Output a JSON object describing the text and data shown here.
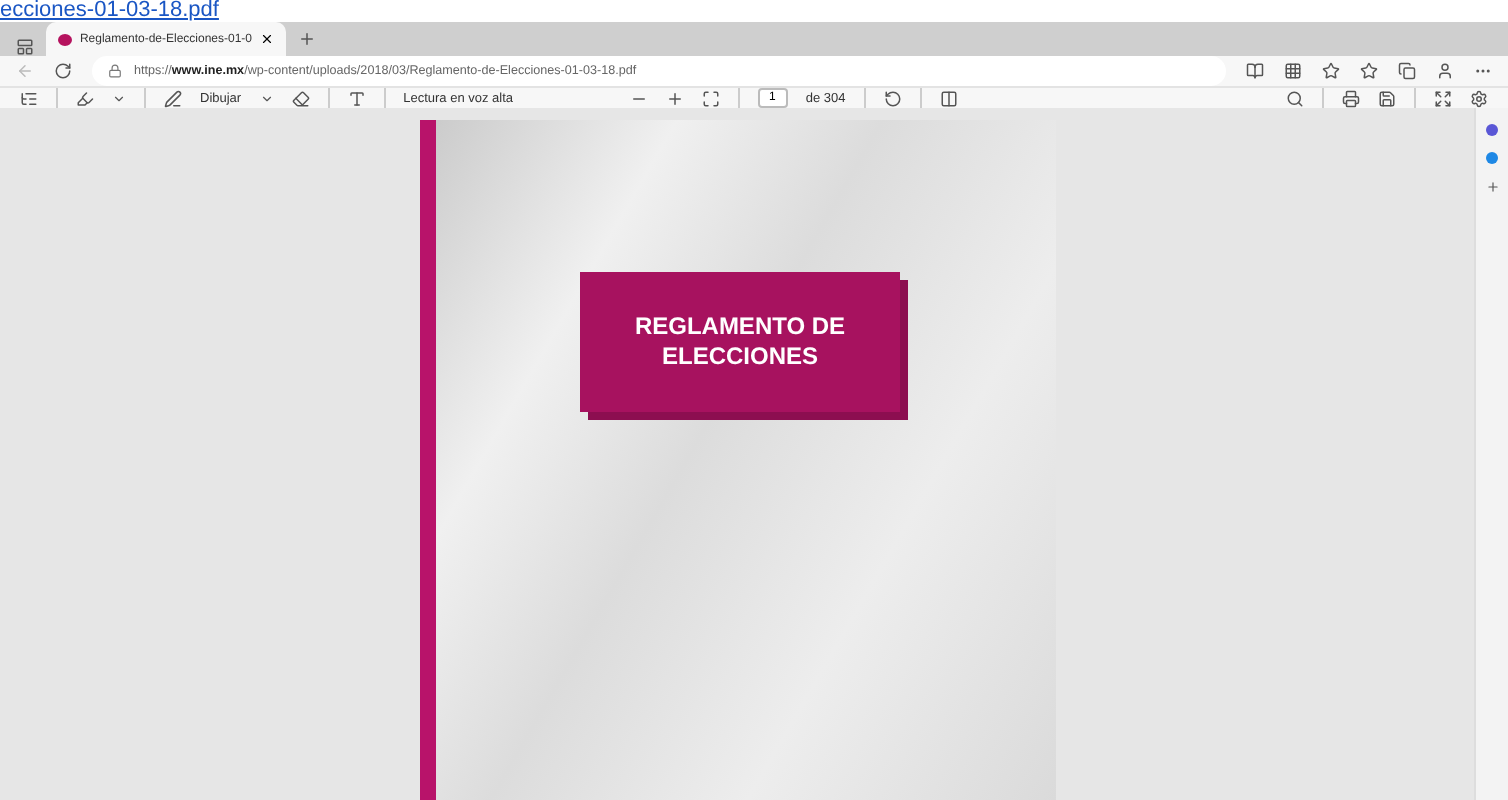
{
  "page_link": "ecciones-01-03-18.pdf",
  "tabs": [
    {
      "title": "Reglamento-de-Elecciones-01-0",
      "selected": true
    }
  ],
  "address_bar": {
    "url": "https://**www.ine.mx**/wp-content/uploads/2018/03/Reglamento-de-Elecciones-01-03-18.pdf"
  },
  "pdf_toolbar": {
    "draw_label": "Dibujar",
    "read_aloud_label": "Lectura en voz alta",
    "page_number": "1",
    "page_total": "de 304"
  },
  "document": {
    "cover_title": [
      "REGLAMENTO DE",
      "ELECCIONES"
    ]
  }
}
